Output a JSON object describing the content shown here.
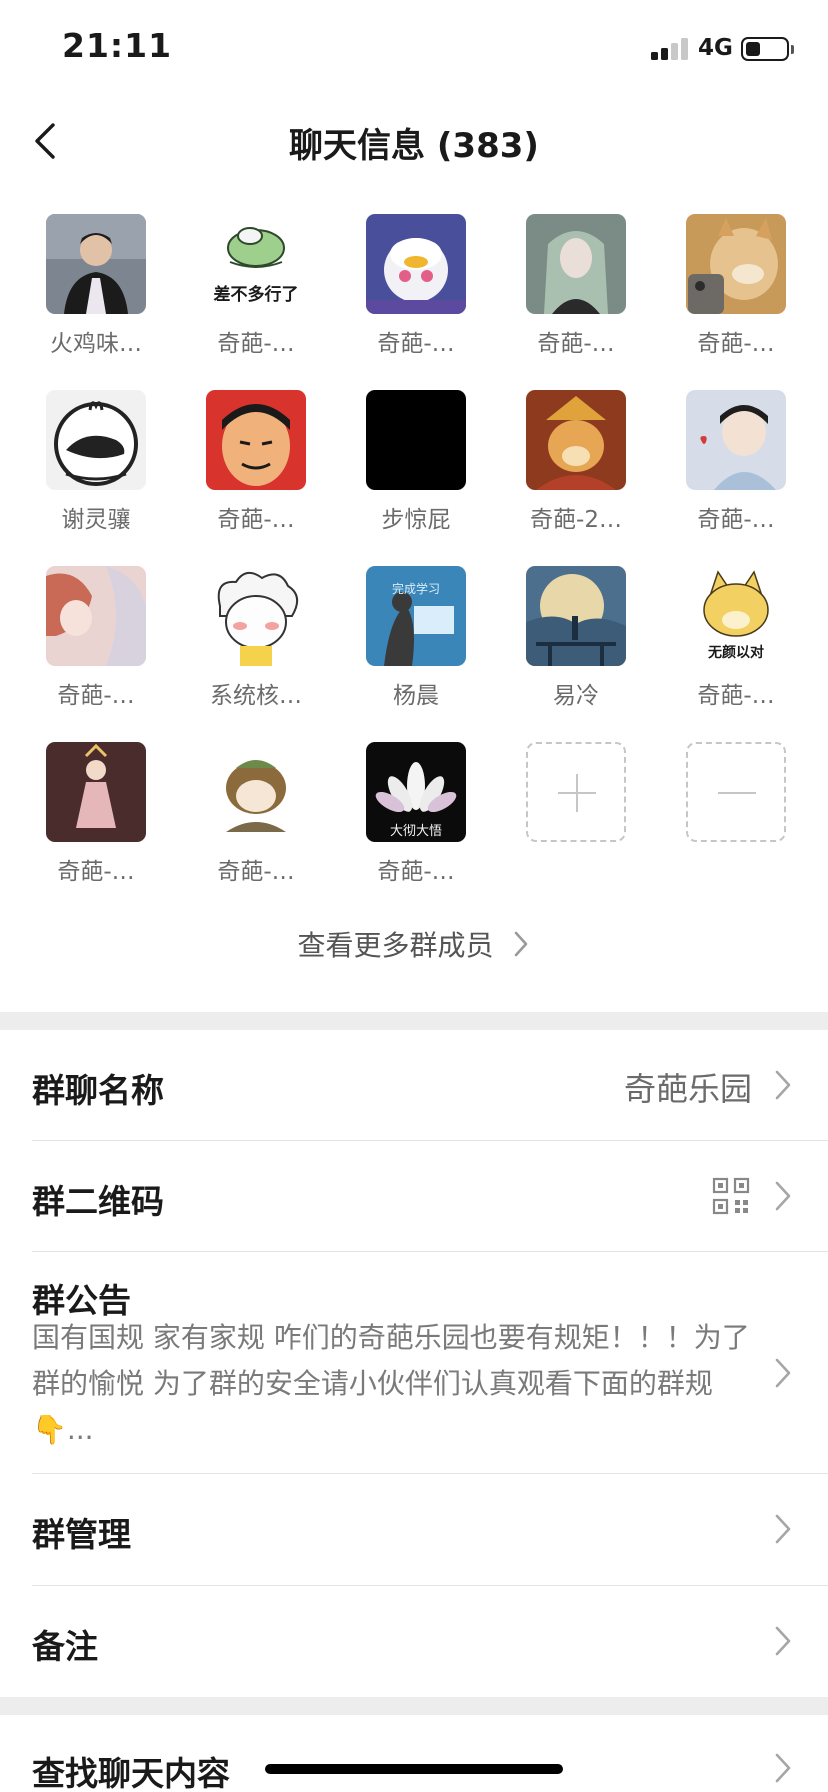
{
  "status_bar": {
    "time": "21:11",
    "network": "4G"
  },
  "nav": {
    "title": "聊天信息 (383)"
  },
  "members": [
    {
      "name": "火鸡味…",
      "bg": "#7d8690",
      "fg": "#1b1b1b"
    },
    {
      "name": "奇葩-…",
      "bg": "#ffffff",
      "fg": "#3f6a3a",
      "caption": "差不多行了"
    },
    {
      "name": "奇葩-…",
      "bg": "#4a4f9c",
      "fg": "#f4f4f8"
    },
    {
      "name": "奇葩-…",
      "bg": "#7b8c86",
      "fg": "#b4c8b6"
    },
    {
      "name": "奇葩-…",
      "bg": "#c79a5a",
      "fg": "#e9cf9e"
    },
    {
      "name": "谢灵骧",
      "bg": "#f1f1f1",
      "fg": "#222222"
    },
    {
      "name": "奇葩-…",
      "bg": "#d9332e",
      "fg": "#f0b27a"
    },
    {
      "name": "步惊屁",
      "bg": "#000000",
      "fg": "#000000"
    },
    {
      "name": "奇葩-2…",
      "bg": "#8e3a1e",
      "fg": "#e7a654"
    },
    {
      "name": "奇葩-…",
      "bg": "#d6dde8",
      "fg": "#3a3a3a"
    },
    {
      "name": "奇葩-…",
      "bg": "#e9d4d2",
      "fg": "#c86a55"
    },
    {
      "name": "系统核…",
      "bg": "#ffffff",
      "fg": "#f5d24c"
    },
    {
      "name": "杨晨",
      "bg": "#3a86b8",
      "fg": "#d9eefa",
      "caption": "完成学习"
    },
    {
      "name": "易冷",
      "bg": "#4c6f8e",
      "fg": "#e8d7a8"
    },
    {
      "name": "奇葩-…",
      "bg": "#ffffff",
      "fg": "#f3d062",
      "caption": "无颜以对"
    },
    {
      "name": "奇葩-…",
      "bg": "#4b2c2c",
      "fg": "#e6b7b9"
    },
    {
      "name": "奇葩-…",
      "bg": "#ffffff",
      "fg": "#7a6a4a"
    },
    {
      "name": "奇葩-…",
      "bg": "#0b0b0b",
      "fg": "#f4f4f4",
      "caption": "大彻大悟"
    }
  ],
  "more_members": "查看更多群成员",
  "settings": {
    "group_name_label": "群聊名称",
    "group_name_value": "奇葩乐园",
    "qr_label": "群二维码",
    "notice_label": "群公告",
    "notice_text": "国有国规 家有家规 咋们的奇葩乐园也要有规矩！！！为了群的愉悦 为了群的安全请小伙伴们认真观看下面的群规 👇...",
    "manage_label": "群管理",
    "remark_label": "备注",
    "search_label": "查找聊天内容"
  },
  "icons": {
    "back": "chevron-left-icon",
    "chevron": "chevron-right-icon",
    "qr": "qr-code-icon",
    "add": "plus-icon",
    "remove": "minus-icon"
  }
}
